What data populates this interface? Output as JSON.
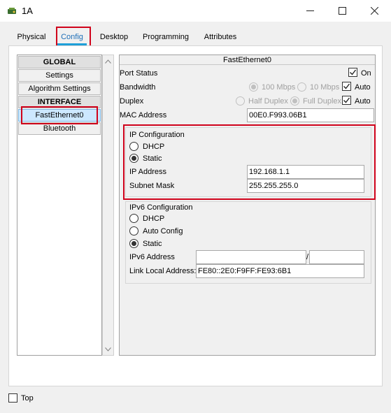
{
  "window": {
    "title": "1A",
    "min_icon": "minimize-icon",
    "max_icon": "maximize-icon",
    "close_icon": "close-icon"
  },
  "tabs": [
    {
      "label": "Physical"
    },
    {
      "label": "Config"
    },
    {
      "label": "Desktop"
    },
    {
      "label": "Programming"
    },
    {
      "label": "Attributes"
    }
  ],
  "left_list": {
    "global_header": "GLOBAL",
    "settings": "Settings",
    "algorithm_settings": "Algorithm Settings",
    "interface_header": "INTERFACE",
    "fastethernet": "FastEthernet0",
    "bluetooth": "Bluetooth"
  },
  "panel": {
    "title": "FastEthernet0",
    "port_status_label": "Port Status",
    "port_status_on": "On",
    "bandwidth_label": "Bandwidth",
    "bw_100": "100 Mbps",
    "bw_10": "10 Mbps",
    "bw_auto": "Auto",
    "duplex_label": "Duplex",
    "half_duplex": "Half Duplex",
    "full_duplex": "Full Duplex",
    "duplex_auto": "Auto",
    "mac_label": "MAC Address",
    "mac_value": "00E0.F993.06B1"
  },
  "ipv4": {
    "title": "IP Configuration",
    "dhcp": "DHCP",
    "static": "Static",
    "ip_label": "IP Address",
    "ip_value": "192.168.1.1",
    "mask_label": "Subnet Mask",
    "mask_value": "255.255.255.0"
  },
  "ipv6": {
    "title": "IPv6 Configuration",
    "dhcp": "DHCP",
    "auto_config": "Auto Config",
    "static": "Static",
    "addr_label": "IPv6 Address",
    "addr_value": "",
    "prefix_sep": "/",
    "prefix_value": "",
    "link_local_label": "Link Local Address:",
    "link_local_value": "FE80::2E0:F9FF:FE93:6B1"
  },
  "footer": {
    "top_label": "Top"
  },
  "colors": {
    "highlight_red": "#d0021b",
    "tab_accent": "#1e9fd8"
  }
}
